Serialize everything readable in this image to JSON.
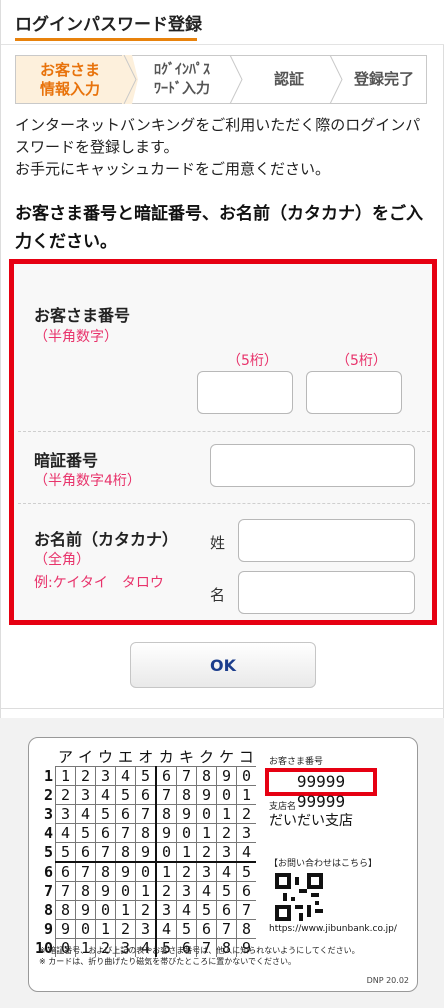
{
  "header": {
    "title": "ログインパスワード登録"
  },
  "steps": [
    {
      "label": "お客さま\n情報入力",
      "active": true
    },
    {
      "label": "ﾛｸﾞｲﾝﾊﾟｽ\nﾜｰﾄﾞ入力",
      "active": false
    },
    {
      "label": "認証",
      "active": false
    },
    {
      "label": "登録完了",
      "active": false
    }
  ],
  "intro": {
    "line1": "インターネットバンキングをご利用いただく際のログインパスワードを登録します。",
    "line2": "お手元にキャッシュカードをご用意ください。"
  },
  "instruction": "お客さま番号と暗証番号、お名前（カタカナ）をご入力ください。",
  "form": {
    "customer_number": {
      "label": "お客さま番号",
      "note": "（半角数字）",
      "digits_a": "（5桁）",
      "digits_b": "（5桁）"
    },
    "pin": {
      "label": "暗証番号",
      "note": "（半角数字4桁）"
    },
    "name": {
      "label": "お名前（カタカナ）",
      "note": "（全角）",
      "example": "例:ケイタイ　タロウ",
      "last_label": "姓",
      "first_label": "名"
    }
  },
  "ok_button": "OK",
  "card": {
    "header_letters": [
      "ア",
      "イ",
      "ウ",
      "エ",
      "オ",
      "カ",
      "キ",
      "ク",
      "ケ",
      "コ"
    ],
    "rows": [
      {
        "n": "1",
        "d": [
          "1",
          "2",
          "3",
          "4",
          "5",
          "6",
          "7",
          "8",
          "9",
          "0"
        ]
      },
      {
        "n": "2",
        "d": [
          "2",
          "3",
          "4",
          "5",
          "6",
          "7",
          "8",
          "9",
          "0",
          "1"
        ]
      },
      {
        "n": "3",
        "d": [
          "3",
          "4",
          "5",
          "6",
          "7",
          "8",
          "9",
          "0",
          "1",
          "2"
        ]
      },
      {
        "n": "4",
        "d": [
          "4",
          "5",
          "6",
          "7",
          "8",
          "9",
          "0",
          "1",
          "2",
          "3"
        ]
      },
      {
        "n": "5",
        "d": [
          "5",
          "6",
          "7",
          "8",
          "9",
          "0",
          "1",
          "2",
          "3",
          "4"
        ]
      },
      {
        "n": "6",
        "d": [
          "6",
          "7",
          "8",
          "9",
          "0",
          "1",
          "2",
          "3",
          "4",
          "5"
        ]
      },
      {
        "n": "7",
        "d": [
          "7",
          "8",
          "9",
          "0",
          "1",
          "2",
          "3",
          "4",
          "5",
          "6"
        ]
      },
      {
        "n": "8",
        "d": [
          "8",
          "9",
          "0",
          "1",
          "2",
          "3",
          "4",
          "5",
          "6",
          "7"
        ]
      },
      {
        "n": "9",
        "d": [
          "9",
          "0",
          "1",
          "2",
          "3",
          "4",
          "5",
          "6",
          "7",
          "8"
        ]
      },
      {
        "n": "10",
        "d": [
          "0",
          "1",
          "2",
          "3",
          "4",
          "5",
          "6",
          "7",
          "8",
          "9"
        ]
      }
    ],
    "customer_number_label": "お客さま番号",
    "customer_number": "99999 99999",
    "branch_label": "支店名",
    "branch": "だいだい支店",
    "contact": "【お問い合わせはこちら】",
    "url": "https://www.jibunbank.co.jp/",
    "note1": "※ 暗証番号、および上記の表やお客さま番号は、他人に知られないようにしてください。",
    "note2": "※ カードは、折り曲げたり磁気を帯びたところに置かないでください。",
    "code": "DNP 20.02"
  },
  "colors": {
    "accent": "#e8820c",
    "alert_red": "#e60012",
    "note_pink": "#e8336b",
    "ok_text": "#1c3d8c"
  }
}
